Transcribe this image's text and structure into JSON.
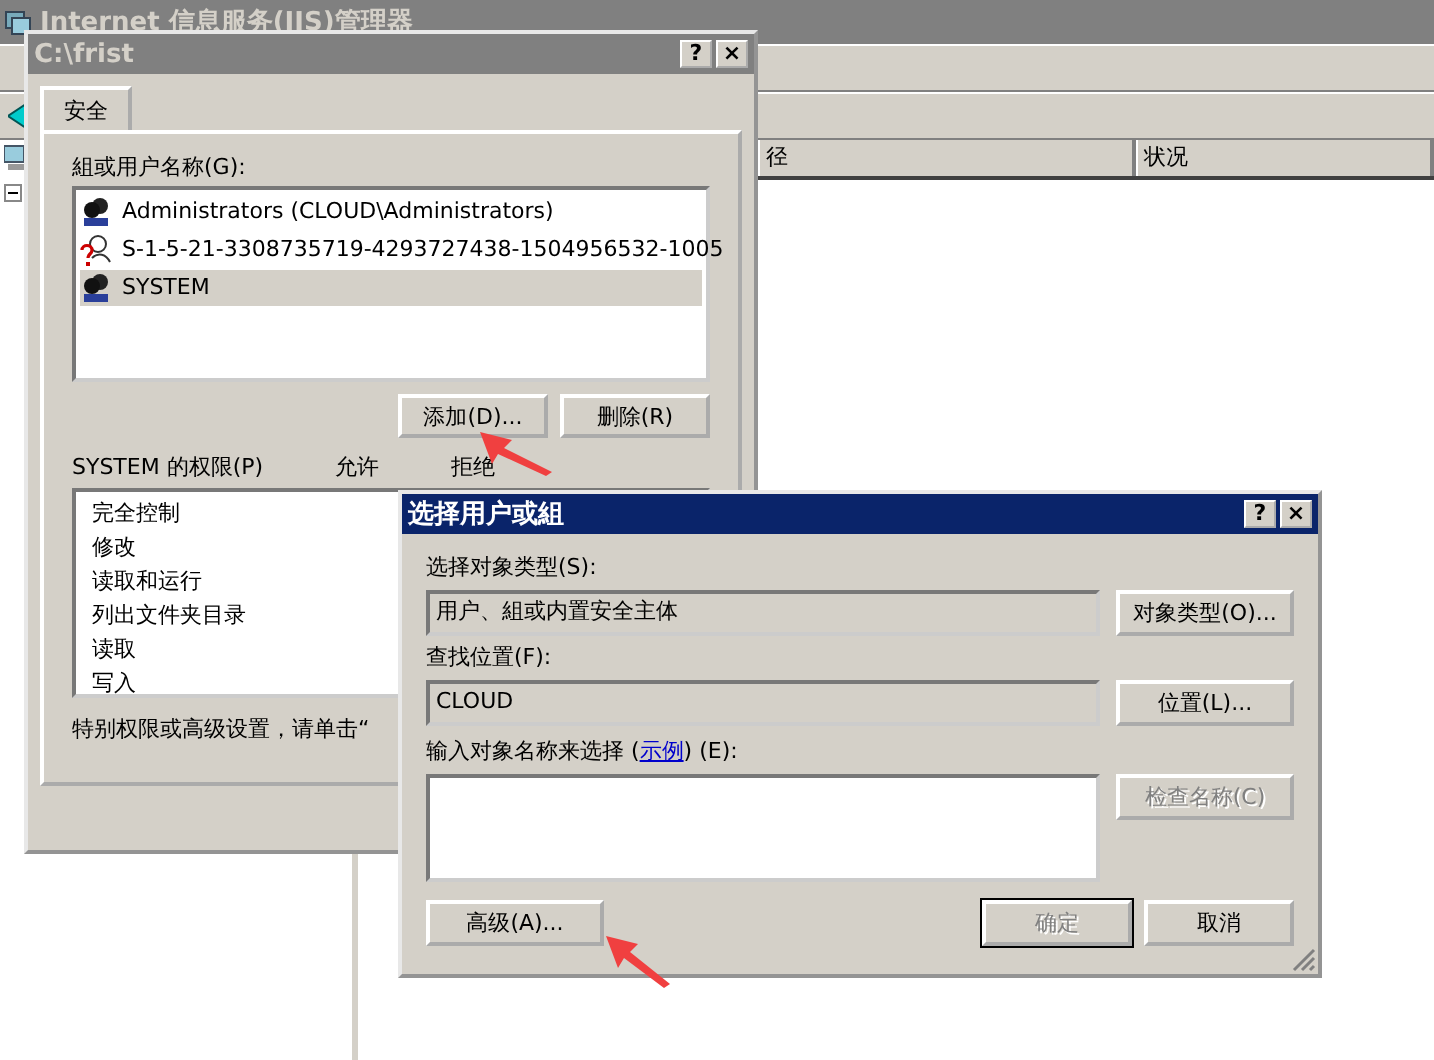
{
  "background_window": {
    "title": "Internet 信息服务(IIS)管理器",
    "active": false,
    "columns": [
      "径",
      "状况"
    ]
  },
  "security_dialog": {
    "title": "C:\\frist",
    "active": false,
    "title_buttons": [
      "?",
      "×"
    ],
    "tabs": [
      {
        "label": "安全",
        "selected": true
      }
    ],
    "users_label": "組或用户名称(G):",
    "users": [
      {
        "name": "Administrators (CLOUD\\Administrators)",
        "kind": "group",
        "selected": false
      },
      {
        "name": "S-1-5-21-3308735719-4293727438-1504956532-1005",
        "kind": "unknown",
        "selected": false
      },
      {
        "name": "SYSTEM",
        "kind": "group",
        "selected": true
      }
    ],
    "buttons": [
      {
        "label": "添加(D)..."
      },
      {
        "label": "删除(R)"
      }
    ],
    "permissions_label": "SYSTEM 的权限(P)",
    "permission_columns": [
      "允许",
      "拒绝"
    ],
    "permissions": [
      "完全控制",
      "修改",
      "读取和运行",
      "列出文件夹目录",
      "读取",
      "写入"
    ],
    "note": "特别权限或高级设置，请单击“"
  },
  "select_dialog": {
    "title": "选择用户或組",
    "active": true,
    "title_buttons": [
      "?",
      "×"
    ],
    "object_type_label": "选择对象类型(S):",
    "object_type": "用户、組或内置安全主体",
    "object_type_button": {
      "label": "对象类型(O)...",
      "disabled": false
    },
    "location_label": "查找位置(F):",
    "location": "CLOUD",
    "location_button": {
      "label": "位置(L)...",
      "disabled": false
    },
    "names_label_before": "输入对象名称来选择 (",
    "names_link": "示例",
    "names_label_after": ") (E):",
    "check_button": {
      "label": "检查名称(C)",
      "disabled": true
    },
    "advanced_button": {
      "label": "高级(A)...",
      "disabled": false
    },
    "ok_button": {
      "label": "确定",
      "disabled": true,
      "default": true
    },
    "cancel_button": {
      "label": "取消",
      "disabled": false,
      "default": false
    }
  }
}
